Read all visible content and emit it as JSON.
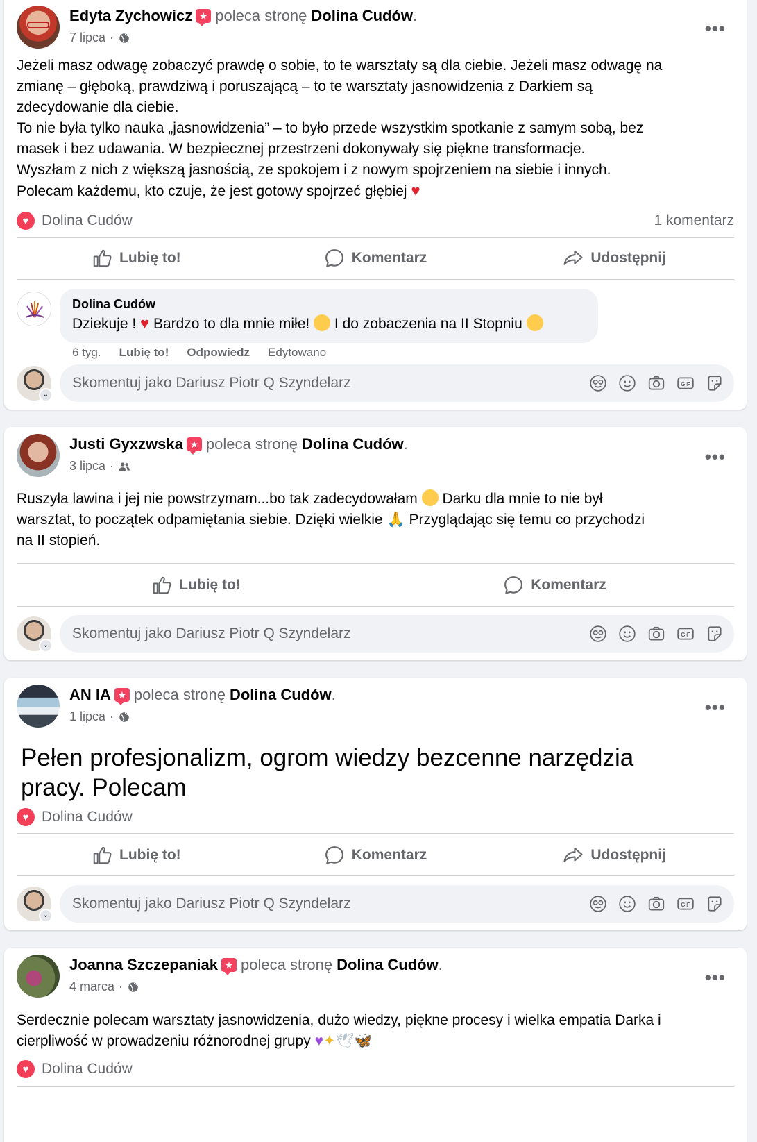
{
  "comment_placeholder": "Skomentuj jako Dariusz Piotr Q Szyndelarz",
  "actions": {
    "like": "Lubię to!",
    "comment": "Komentarz",
    "share": "Udostępnij"
  },
  "recommends": "poleca stronę",
  "page_name": "Dolina Cudów",
  "posts": [
    {
      "author": "Edyta Zychowicz",
      "date": "7 lipca",
      "privacy_icon": "globe-icon",
      "text": [
        "Jeżeli masz odwagę zobaczyć prawdę o sobie, to te warsztaty są dla ciebie. Jeżeli masz odwagę na",
        "zmianę – głęboką, prawdziwą i poruszającą – to te warsztaty jasnowidzenia z Darkiem są",
        "zdecydowanie dla ciebie.",
        "To nie była tylko nauka „jasnowidzenia” – to było przede wszystkim spotkanie z samym sobą, bez",
        "masek i bez udawania. W bezpiecznej przestrzeni dokonywały się piękne transformacje.",
        "Wyszłam z nich z większą jasnością, ze spokojem i z nowym spojrzeniem na siebie i innych.",
        "Polecam każdemu, kto czuje, że jest gotowy spojrzeć głębiej"
      ],
      "reaction_by": "Dolina Cudów",
      "comment_count": "1 komentarz",
      "reply": {
        "author": "Dolina Cudów",
        "text_1": "Dziekuje !",
        "text_2": "Bardzo to dla mnie miłe!",
        "text_3": "I do zobaczenia na II Stopniu",
        "time": "6 tyg.",
        "like": "Lubię to!",
        "reply": "Odpowiedz",
        "edited": "Edytowano"
      }
    },
    {
      "author": "Justi Gyxzwska",
      "date": "3 lipca",
      "privacy_icon": "friends-icon",
      "text": [
        "Ruszyła lawina i jej nie powstrzymam...bo tak zadecydowałam",
        "Darku dla mnie to nie był",
        "warsztat, to początek odpamiętania siebie. Dzięki wielkie",
        "Przyglądając się temu co przychodzi",
        "na II stopień."
      ]
    },
    {
      "author": "AN IA",
      "date": "1 lipca",
      "privacy_icon": "globe-icon",
      "text": [
        "Pełen profesjonalizm, ogrom wiedzy bezcenne narzędzia",
        "pracy. Polecam"
      ],
      "reaction_by": "Dolina Cudów"
    },
    {
      "author": "Joanna Szczepaniak",
      "date": "4 marca",
      "privacy_icon": "globe-icon",
      "text": [
        "Serdecznie polecam warsztaty jasnowidzenia, dużo wiedzy, piękne procesy i wielka empatia Darka i",
        "cierpliwość w prowadzeniu różnorodnej grupy"
      ],
      "reaction_by": "Dolina Cudów"
    }
  ]
}
